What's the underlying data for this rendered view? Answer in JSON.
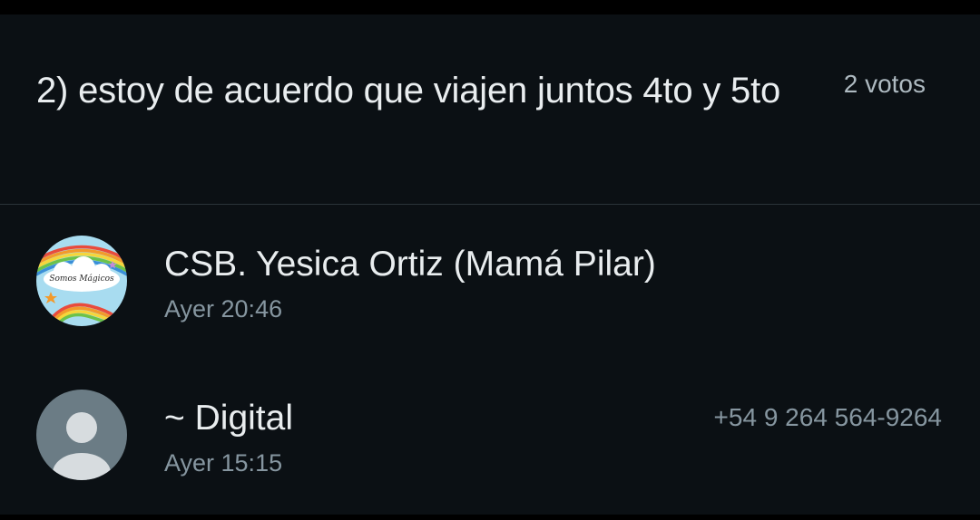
{
  "poll_option": {
    "text": "2) estoy de acuerdo que viajen juntos 4to y 5to",
    "votes_label": "2 votos"
  },
  "voters": [
    {
      "name": "CSB. Yesica Ortiz (Mamá Pilar)",
      "time": "Ayer 20:46",
      "phone": "",
      "avatar": "somos-magicos-rainbow-avatar",
      "avatar_text": "Somos Mágicos"
    },
    {
      "name": "~ Digital",
      "time": "Ayer 15:15",
      "phone": "+54 9 264 564-9264",
      "avatar": "default-person-avatar"
    }
  ],
  "colors": {
    "background": "#0b1014",
    "primary_text": "#e9edef",
    "secondary_text": "#8696a0",
    "divider": "#2a3339",
    "default_avatar_bg": "#6b7c85"
  }
}
